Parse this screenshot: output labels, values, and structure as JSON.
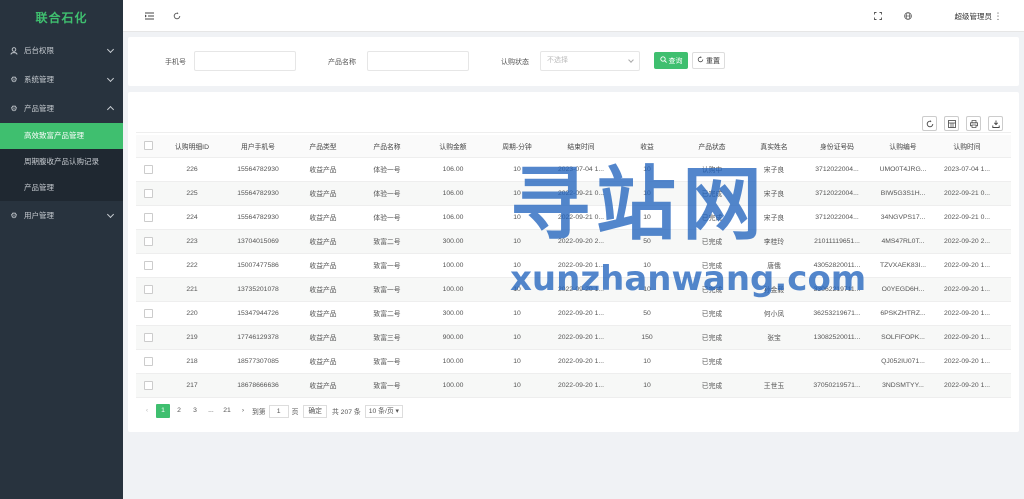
{
  "app": {
    "logo": "联合石化"
  },
  "sidebar": {
    "items": [
      {
        "label": "后台权限",
        "icon": "user-icon",
        "expanded": false
      },
      {
        "label": "系统管理",
        "icon": "gear-icon",
        "expanded": false
      },
      {
        "label": "产品管理",
        "icon": "gear-icon",
        "expanded": true,
        "children": [
          {
            "label": "高效致富产品管理",
            "active": true
          },
          {
            "label": "周期腹收产品认购记录",
            "active": false
          },
          {
            "label": "产品管理",
            "active": false
          }
        ]
      },
      {
        "label": "用户管理",
        "icon": "gear-icon",
        "expanded": false
      }
    ]
  },
  "header": {
    "admin": "超级管理员"
  },
  "search": {
    "phone_label": "手机号",
    "phone_value": "",
    "product_label": "产品名称",
    "product_value": "",
    "status_label": "认购状态",
    "status_placeholder": "不选择",
    "query_label": "查询",
    "reset_label": "重置"
  },
  "table": {
    "columns": [
      "认购明细ID",
      "用户手机号",
      "产品类型",
      "产品名称",
      "认购金额",
      "周期-分钟",
      "结束时间",
      "收益",
      "产品状态",
      "真实姓名",
      "身份证号码",
      "认购编号",
      "认购时间"
    ],
    "rows": [
      [
        "226",
        "15564782930",
        "收益产品",
        "体验一号",
        "106.00",
        "10",
        "2023-07-04 1...",
        "10",
        "认购中",
        "宋子良",
        "3712022004...",
        "UMO0T4JRG...",
        "2023-07-04 1..."
      ],
      [
        "225",
        "15564782930",
        "收益产品",
        "体验一号",
        "106.00",
        "10",
        "2022-09-21 0...",
        "10",
        "已完成",
        "宋子良",
        "3712022004...",
        "BIW5G3S1H...",
        "2022-09-21 0..."
      ],
      [
        "224",
        "15564782930",
        "收益产品",
        "体验一号",
        "106.00",
        "10",
        "2022-09-21 0...",
        "10",
        "已完成",
        "宋子良",
        "3712022004...",
        "34NGVPS17...",
        "2022-09-21 0..."
      ],
      [
        "223",
        "13704015069",
        "收益产品",
        "致富二号",
        "300.00",
        "10",
        "2022-09-20 2...",
        "50",
        "已完成",
        "李桂玲",
        "21011119651...",
        "4MS47RL0T...",
        "2022-09-20 2..."
      ],
      [
        "222",
        "15007477586",
        "收益产品",
        "致富一号",
        "100.00",
        "10",
        "2022-09-20 1...",
        "10",
        "已完成",
        "唐俄",
        "43052820011...",
        "TZVXAEK83I...",
        "2022-09-20 1..."
      ],
      [
        "221",
        "13735201078",
        "收益产品",
        "致富一号",
        "100.00",
        "10",
        "2022-09-20 1...",
        "10",
        "已完成",
        "孙金毅",
        "33062219711...",
        "O0YEGD6H...",
        "2022-09-20 1..."
      ],
      [
        "220",
        "15347944726",
        "收益产品",
        "致富二号",
        "300.00",
        "10",
        "2022-09-20 1...",
        "50",
        "已完成",
        "何小凤",
        "36253219671...",
        "6PSKZHTRZ...",
        "2022-09-20 1..."
      ],
      [
        "219",
        "17746129378",
        "收益产品",
        "致富三号",
        "900.00",
        "10",
        "2022-09-20 1...",
        "150",
        "已完成",
        "张宝",
        "13082520011...",
        "SOLFIFOPK...",
        "2022-09-20 1..."
      ],
      [
        "218",
        "18577307085",
        "收益产品",
        "致富一号",
        "100.00",
        "10",
        "2022-09-20 1...",
        "10",
        "已完成",
        "",
        "",
        "QJ052IU071...",
        "2022-09-20 1..."
      ],
      [
        "217",
        "18678666636",
        "收益产品",
        "致富一号",
        "100.00",
        "10",
        "2022-09-20 1...",
        "10",
        "已完成",
        "王世玉",
        "37050219571...",
        "3NDSMTYY...",
        "2022-09-20 1..."
      ]
    ]
  },
  "pagination": {
    "pages": [
      "1",
      "2",
      "3",
      "...",
      "21"
    ],
    "goto_label": "到第",
    "goto_value": "1",
    "page_unit": "页",
    "confirm_label": "确定",
    "total_label": "共 207 条",
    "page_size_label": "10 条/页"
  },
  "watermark": {
    "cn": "寻站网",
    "en": "xunzhanwang.com"
  },
  "colors": {
    "accent": "#3fbf6f",
    "sidebar_bg": "#28333e",
    "watermark": "#2264be"
  }
}
